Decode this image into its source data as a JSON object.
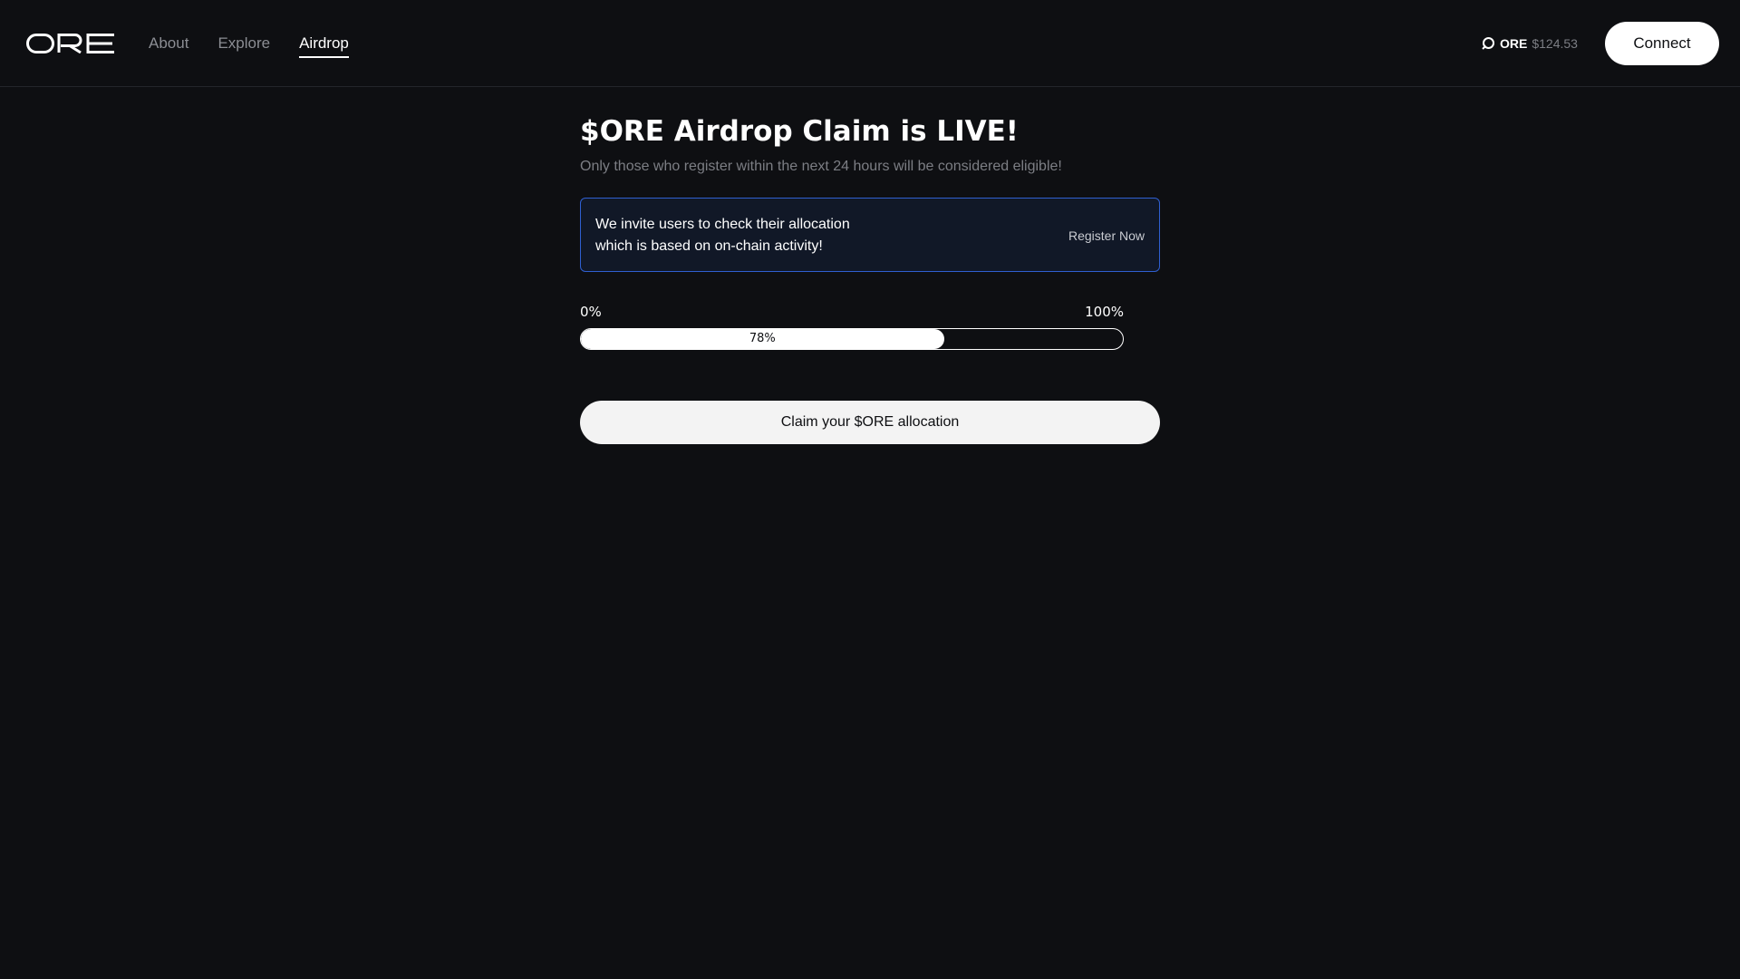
{
  "header": {
    "logo_text": "ORE",
    "nav": [
      {
        "label": "About",
        "active": false
      },
      {
        "label": "Explore",
        "active": false
      },
      {
        "label": "Airdrop",
        "active": true
      }
    ],
    "price": {
      "icon": "ore-coin-icon",
      "symbol": "ORE",
      "value": "$124.53"
    },
    "connect_label": "Connect"
  },
  "main": {
    "title": "$ORE Airdrop Claim is LIVE!",
    "subtitle": "Only those who register within the next 24 hours will be considered eligible!",
    "notice": {
      "line1": "We invite users to check their allocation",
      "line2": "which is based on on-chain activity!",
      "action_label": "Register Now"
    },
    "progress": {
      "min_label": "0%",
      "max_label": "100%",
      "value_label": "78%",
      "value": 0.67
    },
    "claim_label": "Claim your $ORE allocation"
  },
  "colors": {
    "background": "#0e0f12",
    "notice_border": "#2f5fd0",
    "notice_bg": "#111827",
    "muted_text": "#7c7e84"
  }
}
